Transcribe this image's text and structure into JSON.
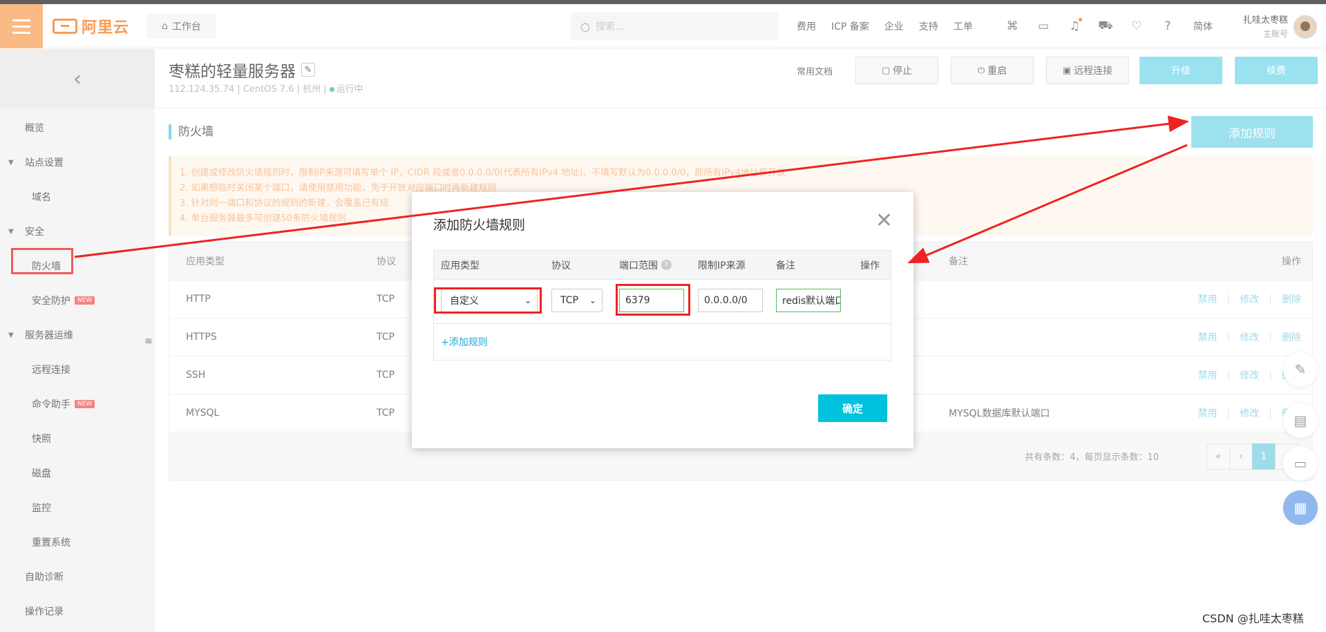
{
  "topbar": {
    "logo_text": "阿里云",
    "workbench_label": "工作台",
    "search_placeholder": "搜索...",
    "links": [
      "费用",
      "ICP 备案",
      "企业",
      "支持",
      "工单"
    ],
    "language": "简体",
    "user_name": "扎哇太枣糕",
    "user_role": "主账号"
  },
  "sidebar": {
    "items": [
      {
        "label": "概览"
      },
      {
        "label": "站点设置"
      },
      {
        "label": "域名"
      },
      {
        "label": "安全"
      },
      {
        "label": "防火墙"
      },
      {
        "label": "安全防护",
        "badge": "NEW"
      },
      {
        "label": "服务器运维"
      },
      {
        "label": "远程连接"
      },
      {
        "label": "命令助手",
        "badge": "NEW"
      },
      {
        "label": "快照"
      },
      {
        "label": "磁盘"
      },
      {
        "label": "监控"
      },
      {
        "label": "重置系统"
      },
      {
        "label": "自助诊断"
      },
      {
        "label": "操作记录"
      }
    ]
  },
  "server": {
    "title": "枣糕的轻量服务器",
    "ip": "112.124.35.74",
    "os": "CentOS 7.6",
    "region": "杭州",
    "status": "运行中",
    "doc_link": "常用文档",
    "buttons": {
      "stop": "停止",
      "restart": "重启",
      "remote": "远程连接",
      "upgrade": "升级",
      "renew": "续费"
    }
  },
  "firewall": {
    "section_title": "防火墙",
    "add_rule_label": "添加规则",
    "notices": [
      "1. 创建或修改防火墙规则时，限制IP来源可填写单个 IP，CIDR 段或者0.0.0.0/0(代表所有IPv4 地址)，不填写默认为0.0.0.0/0，即所有IPv4地址都开放",
      "2. 如果想临时关闭某个端口，请使用禁用功能，免于开放对应端口时再新建规则",
      "3. 针对同一端口和协议的规则的新建，会覆盖已有规",
      "4. 单台服务器最多可创建50条防火墙规则"
    ],
    "columns": {
      "app_type": "应用类型",
      "protocol": "协议",
      "remark": "备注",
      "ops": "操作"
    },
    "rows": [
      {
        "app": "HTTP",
        "protocol": "TCP",
        "remark": ""
      },
      {
        "app": "HTTPS",
        "protocol": "TCP",
        "remark": ""
      },
      {
        "app": "SSH",
        "protocol": "TCP",
        "remark": ""
      },
      {
        "app": "MYSQL",
        "protocol": "TCP",
        "remark": "MYSQL数据库默认端口"
      }
    ],
    "ops": {
      "disable": "禁用",
      "edit": "修改",
      "delete": "删除"
    },
    "pager": {
      "info": "共有条数：4，每页显示条数：10",
      "first": "«",
      "prev": "‹",
      "current": "1",
      "next": "›"
    }
  },
  "modal": {
    "title": "添加防火墙规则",
    "columns": {
      "app_type": "应用类型",
      "protocol": "协议",
      "port_range": "端口范围",
      "ip_source": "限制IP来源",
      "remark": "备注",
      "ops": "操作"
    },
    "row": {
      "app_type": "自定义",
      "protocol": "TCP",
      "port": "6379",
      "ip_source": "0.0.0.0/0",
      "remark": "redis默认端口"
    },
    "add_rule_link": "+添加规则",
    "confirm_label": "确定"
  },
  "watermark": "CSDN @扎哇太枣糕",
  "colors": {
    "accent": "#00c1de",
    "brand": "#f77a1a",
    "annotation": "#e22222"
  }
}
